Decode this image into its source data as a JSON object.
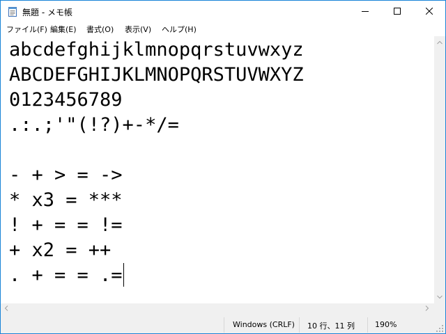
{
  "window": {
    "title": "無題 - メモ帳",
    "icon": "notepad-icon",
    "buttons": [
      "minimize-icon",
      "maximize-icon",
      "close-icon"
    ]
  },
  "menu": {
    "items": [
      {
        "label": "ファイル(F)"
      },
      {
        "label": "編集(E)"
      },
      {
        "label": "書式(O)"
      },
      {
        "label": "表示(V)"
      },
      {
        "label": "ヘルプ(H)"
      }
    ]
  },
  "editor": {
    "lines": [
      "abcdefghijklmnopqrstuvwxyz",
      "ABCDEFGHIJKLMNOPQRSTUVWXYZ",
      "0123456789",
      ".:.;'\"(!?)+-*/=",
      "",
      "- + > = ->",
      "* x3 = ***",
      "! + = = !=",
      "+ x2 = ++",
      ". + = = .="
    ]
  },
  "statusbar": {
    "line_ending": "Windows (CRLF)",
    "position": "10 行、11 列",
    "zoom": "190%"
  },
  "colors": {
    "window_border": "#1883d7",
    "chrome_bg": "#f0f0f0",
    "separator": "#d7d7d7"
  }
}
